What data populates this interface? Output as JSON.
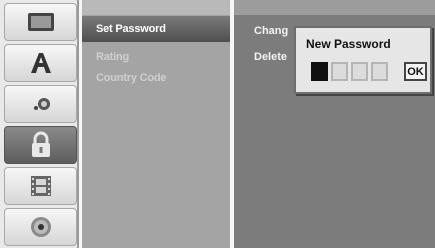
{
  "icons": [
    {
      "name": "disc-settings-icon"
    },
    {
      "name": "language-icon"
    },
    {
      "name": "audio-icon"
    },
    {
      "name": "lock-icon",
      "selected": true
    },
    {
      "name": "film-icon"
    },
    {
      "name": "disc-icon"
    }
  ],
  "menu": {
    "items": [
      {
        "label": "Set Password",
        "state": "active"
      },
      {
        "label": "Rating",
        "state": "dim"
      },
      {
        "label": "Country Code",
        "state": "dim"
      }
    ]
  },
  "options": [
    {
      "label": "Chang"
    },
    {
      "label": "Delete"
    }
  ],
  "popup": {
    "title": "New Password",
    "ok_label": "OK",
    "pin_slots": 4,
    "pin_entered": 1
  },
  "colors": {
    "selection": "#5d5d5d",
    "menu_bg": "#a4a4a4",
    "panel_bg": "#7c7c7c"
  }
}
